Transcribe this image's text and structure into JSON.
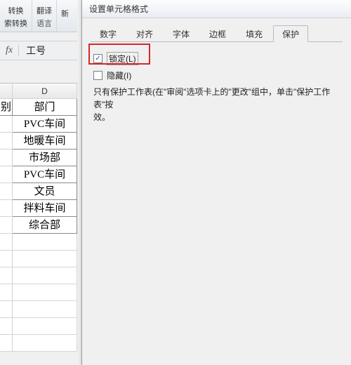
{
  "toolbar": {
    "group1_top": "转换",
    "group1_bottom": "索转换",
    "group2_top": "翻译",
    "group2_label": "语言",
    "group3_partial": "新"
  },
  "formula_bar": {
    "fx": "fx",
    "value": "工号"
  },
  "sheet": {
    "col_left_partial": "别",
    "col_d": "D",
    "header": "部门",
    "rows": [
      "PVC车间",
      "地暖车间",
      "市场部",
      "PVC车间",
      "文员",
      "拌料车间",
      "综合部"
    ]
  },
  "dialog": {
    "title": "设置单元格格式",
    "tabs": [
      "数字",
      "对齐",
      "字体",
      "边框",
      "填充",
      "保护"
    ],
    "active_tab_index": 5,
    "lock_label": "锁定(L)",
    "hide_label": "隐藏(I)",
    "lock_checked": true,
    "hide_checked": false,
    "hint_l1": "只有保护工作表(在\"审阅\"选项卡上的\"更改\"组中，单击\"保护工作表\"按",
    "hint_l2": "效。"
  }
}
